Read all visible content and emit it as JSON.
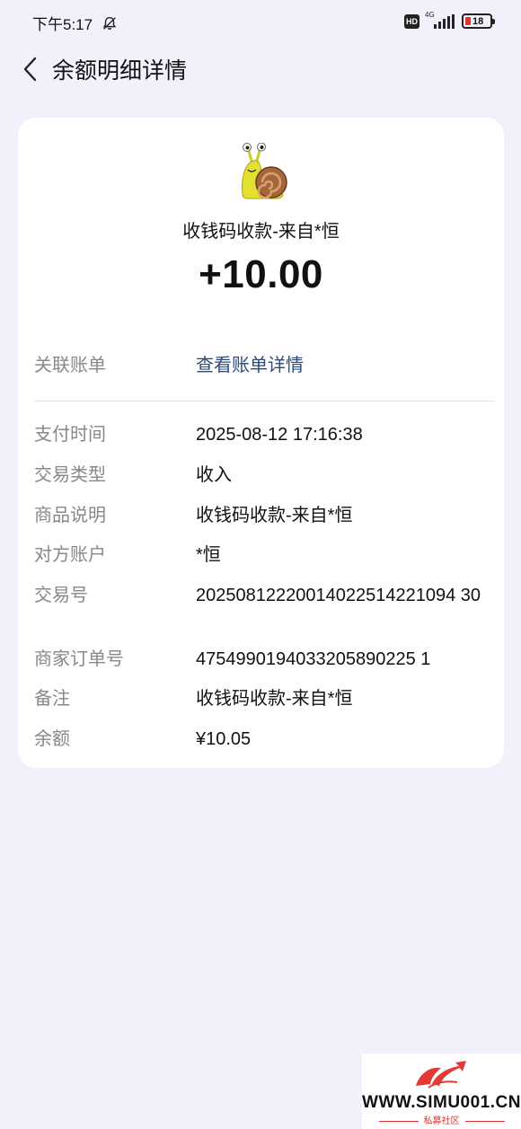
{
  "status_bar": {
    "time": "下午5:17",
    "hd": "HD",
    "network": "4G",
    "battery": "18"
  },
  "header": {
    "title": "余额明细详情"
  },
  "detail": {
    "source_title": "收钱码收款-来自*恒",
    "amount": "+10.00",
    "related_bill": {
      "label": "关联账单",
      "link": "查看账单详情"
    },
    "rows": [
      {
        "label": "支付时间",
        "value": "2025-08-12 17:16:38"
      },
      {
        "label": "交易类型",
        "value": "收入"
      },
      {
        "label": "商品说明",
        "value": "收钱码收款-来自*恒"
      },
      {
        "label": "对方账户",
        "value": "*恒"
      },
      {
        "label": "交易号",
        "value": "20250812220014022514221094 30"
      },
      {
        "label": "商家订单号",
        "value": "4754990194033205890225 1"
      },
      {
        "label": "备注",
        "value": "收钱码收款-来自*恒"
      },
      {
        "label": "余额",
        "value": "¥10.05"
      }
    ]
  },
  "watermark": {
    "site": "WWW.SIMU001.CN",
    "caption": "私募社区"
  },
  "colors": {
    "background": "#f2f0fa",
    "card": "#ffffff",
    "link": "#2c4a7a",
    "label": "#888888"
  }
}
